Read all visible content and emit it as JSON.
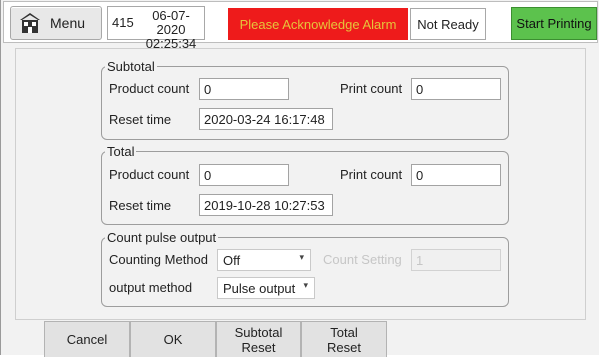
{
  "topbar": {
    "menu_label": "Menu",
    "count": "415",
    "date": "06-07-2020",
    "time": "02:25:34",
    "alarm_text": "Please Acknowledge Alarm",
    "status_text": "Not Ready",
    "start_label": "Start Printing"
  },
  "subtotal": {
    "legend": "Subtotal",
    "product_count_label": "Product count",
    "product_count_value": "0",
    "print_count_label": "Print count",
    "print_count_value": "0",
    "reset_time_label": "Reset time",
    "reset_time_value": "2020-03-24 16:17:48"
  },
  "total": {
    "legend": "Total",
    "product_count_label": "Product count",
    "product_count_value": "0",
    "print_count_label": "Print count",
    "print_count_value": "0",
    "reset_time_label": "Reset time",
    "reset_time_value": "2019-10-28 10:27:53"
  },
  "pulse": {
    "legend": "Count pulse output",
    "counting_method_label": "Counting Method",
    "counting_method_value": "Off",
    "count_setting_label": "Count Setting",
    "count_setting_value": "1",
    "output_method_label": "output method",
    "output_method_value": "Pulse output"
  },
  "buttons": {
    "cancel": "Cancel",
    "ok": "OK",
    "subtotal_reset_1": "Subtotal",
    "subtotal_reset_2": "Reset",
    "total_reset_1": "Total",
    "total_reset_2": "Reset"
  },
  "colors": {
    "alarm_bg": "#ee1b1b",
    "alarm_text": "#e6c43b",
    "start_bg": "#5cc24d"
  },
  "icons": {
    "menu": "home-icon",
    "dropdown": "chevron-down-icon"
  }
}
